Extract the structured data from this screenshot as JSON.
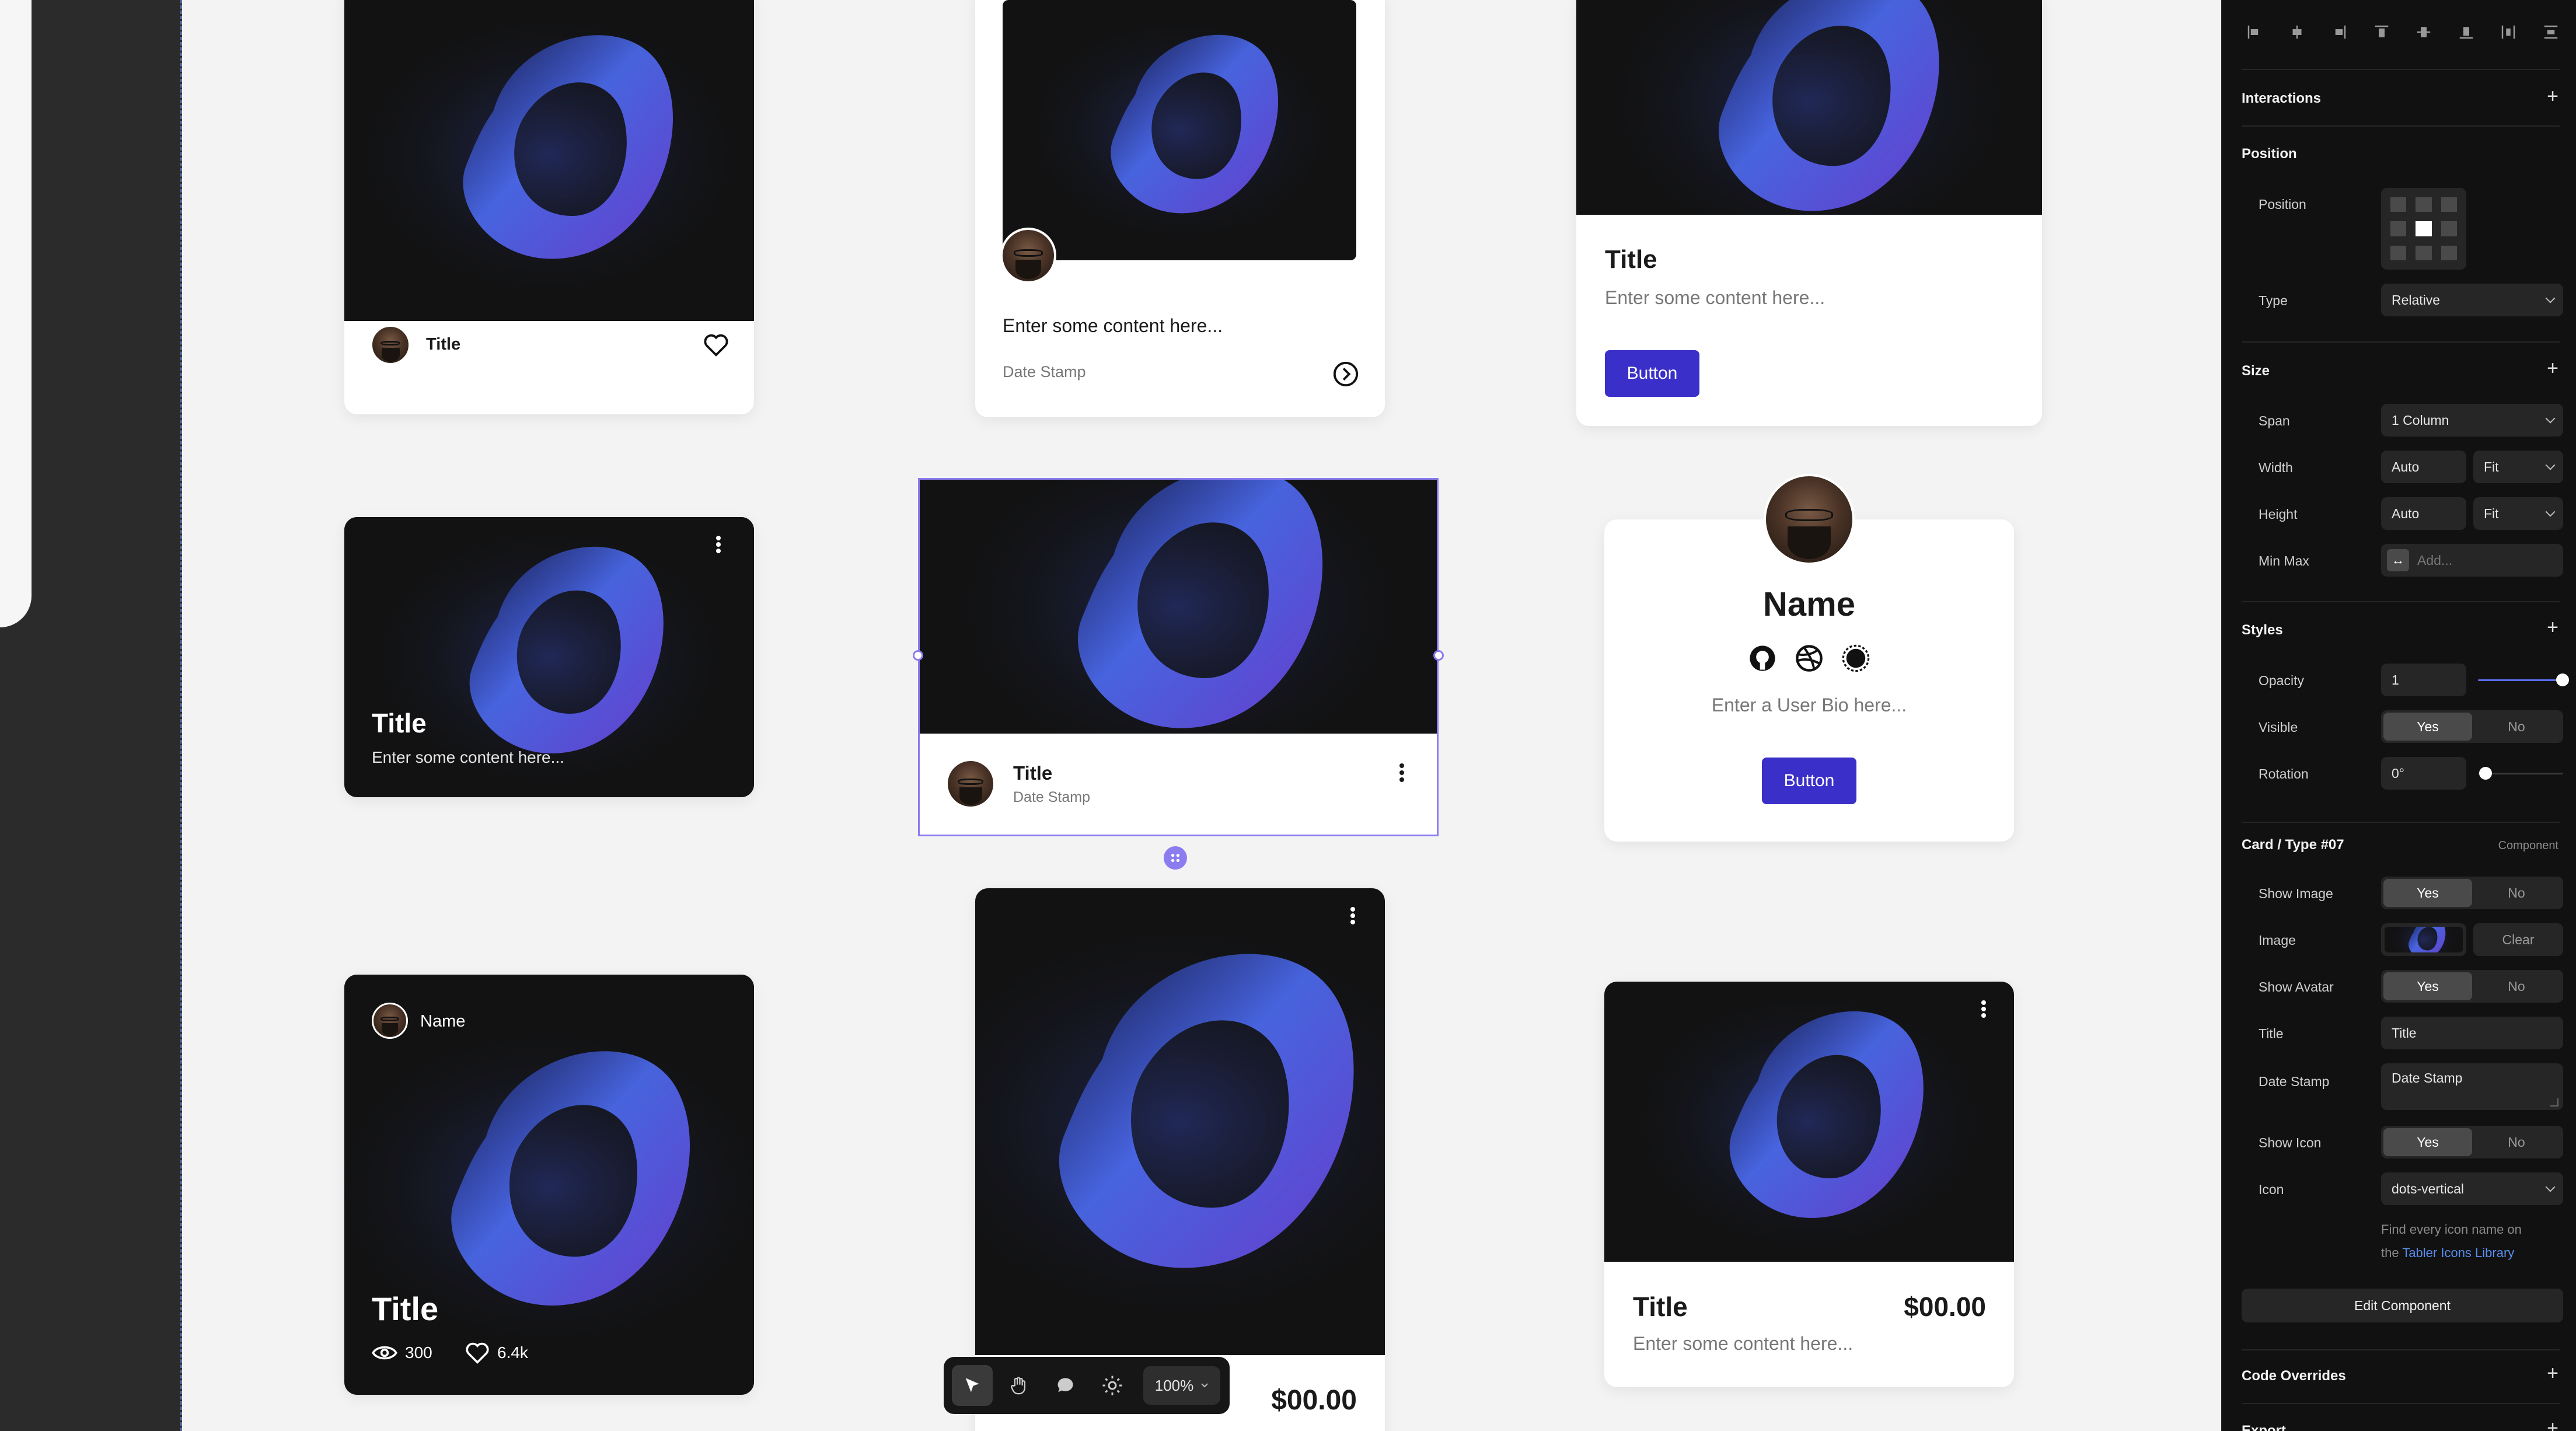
{
  "canvas": {
    "card1": {
      "title": "Title"
    },
    "card2": {
      "content": "Enter some content here...",
      "date_stamp": "Date Stamp"
    },
    "card3": {
      "title": "Title",
      "content": "Enter some content here...",
      "button": "Button"
    },
    "card4": {
      "title": "Title",
      "content": "Enter some content here..."
    },
    "card5": {
      "title": "Title",
      "date_stamp": "Date Stamp"
    },
    "card6": {
      "name": "Name",
      "bio": "Enter a User Bio here...",
      "button": "Button"
    },
    "card7": {
      "name": "Name",
      "title": "Title",
      "views": "300",
      "likes": "6.4k"
    },
    "card8": {
      "price": "$00.00"
    },
    "card9": {
      "title": "Title",
      "price": "$00.00",
      "content": "Enter some content here..."
    }
  },
  "toolbar": {
    "tools": [
      "pointer-icon",
      "hand-icon",
      "comment-icon",
      "sun-icon"
    ],
    "zoom": "100%"
  },
  "panel": {
    "interactions": "Interactions",
    "position_section": "Position",
    "position_label": "Position",
    "type_label": "Type",
    "type_value": "Relative",
    "size_section": "Size",
    "span_label": "Span",
    "span_value": "1 Column",
    "width_label": "Width",
    "width_value": "Auto",
    "width_mode": "Fit",
    "height_label": "Height",
    "height_value": "Auto",
    "height_mode": "Fit",
    "minmax_label": "Min Max",
    "minmax_placeholder": "Add...",
    "styles_section": "Styles",
    "opacity_label": "Opacity",
    "opacity_value": "1",
    "opacity_level": 1,
    "visible_label": "Visible",
    "yes": "Yes",
    "no": "No",
    "rotation_label": "Rotation",
    "rotation_value": "0°",
    "component_title": "Card / Type #07",
    "component_tag": "Component",
    "show_image_label": "Show Image",
    "image_label": "Image",
    "clear": "Clear",
    "show_avatar_label": "Show Avatar",
    "title_label": "Title",
    "title_value": "Title",
    "date_stamp_label": "Date Stamp",
    "date_stamp_value": "Date Stamp",
    "show_icon_label": "Show Icon",
    "icon_label": "Icon",
    "icon_value": "dots-vertical",
    "help_text_1": "Find every icon name on",
    "help_text_2": "the ",
    "help_link": "Tabler Icons Library",
    "edit_component": "Edit Component",
    "code_overrides": "Code Overrides",
    "export": "Export"
  },
  "colors": {
    "accent": "#3b2fc9",
    "selection": "#8b7cf0",
    "link": "#5a8dee"
  }
}
